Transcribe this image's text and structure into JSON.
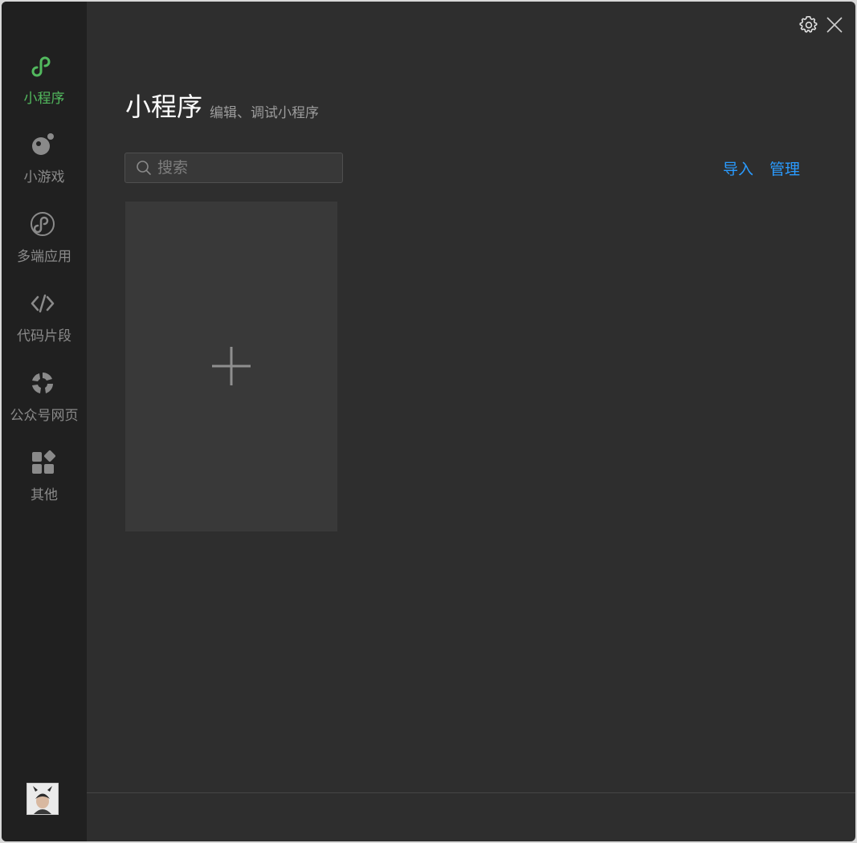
{
  "sidebar": {
    "items": [
      {
        "label": "小程序",
        "icon": "mini-program-icon",
        "active": true
      },
      {
        "label": "小游戏",
        "icon": "mini-game-icon",
        "active": false
      },
      {
        "label": "多端应用",
        "icon": "multi-platform-icon",
        "active": false
      },
      {
        "label": "代码片段",
        "icon": "code-icon",
        "active": false
      },
      {
        "label": "公众号网页",
        "icon": "official-account-icon",
        "active": false
      },
      {
        "label": "其他",
        "icon": "apps-icon",
        "active": false
      }
    ],
    "avatar": "user-avatar"
  },
  "header": {
    "title": "小程序",
    "subtitle": "编辑、调试小程序"
  },
  "search": {
    "placeholder": "搜索"
  },
  "actions": {
    "import_label": "导入",
    "manage_label": "管理"
  },
  "colors": {
    "active": "#52b95e",
    "link": "#2a9bff",
    "sidebar_bg": "#202020",
    "main_bg": "#2e2e2e"
  }
}
